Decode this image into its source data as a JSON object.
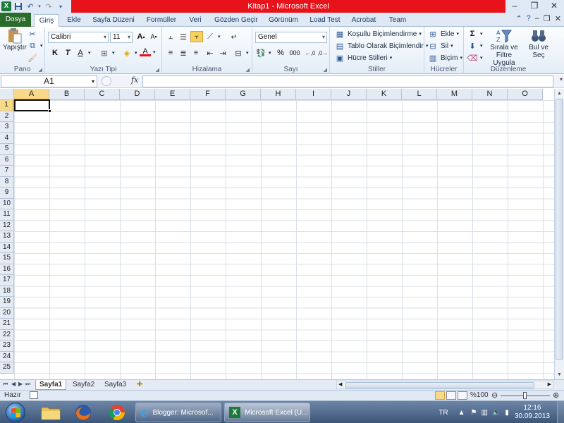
{
  "window": {
    "title": "Kitap1  -  Microsoft Excel",
    "app_logo": "X"
  },
  "ribbon_tabs": [
    "Dosya",
    "Giriş",
    "Ekle",
    "Sayfa Düzeni",
    "Formüller",
    "Veri",
    "Gözden Geçir",
    "Görünüm",
    "Load Test",
    "Acrobat",
    "Team"
  ],
  "active_tab": "Giriş",
  "ribbon": {
    "clipboard": {
      "label": "Pano",
      "paste": "Yapıştır"
    },
    "font": {
      "label": "Yazı Tipi",
      "family": "Calibri",
      "size": "11",
      "bold": "K",
      "italic": "T",
      "underline": "A"
    },
    "alignment": {
      "label": "Hizalama"
    },
    "number": {
      "label": "Sayı",
      "format": "Genel",
      "percent": "%",
      "thousands": "000"
    },
    "styles": {
      "label": "Stiller",
      "conditional": "Koşullu Biçimlendirme",
      "table": "Tablo Olarak Biçimlendir",
      "cell_styles": "Hücre Stilleri"
    },
    "cells": {
      "label": "Hücreler",
      "insert": "Ekle",
      "delete": "Sil",
      "format": "Biçim"
    },
    "editing": {
      "label": "Düzenleme",
      "sort_filter": "Sırala ve Filtre Uygula",
      "find_select": "Bul ve Seç"
    }
  },
  "formula_bar": {
    "name_box": "A1",
    "fx": "fx",
    "value": ""
  },
  "grid": {
    "columns": [
      "A",
      "B",
      "C",
      "D",
      "E",
      "F",
      "G",
      "H",
      "I",
      "J",
      "K",
      "L",
      "M",
      "N",
      "O"
    ],
    "rows": [
      "1",
      "2",
      "3",
      "4",
      "5",
      "6",
      "7",
      "8",
      "9",
      "10",
      "11",
      "12",
      "13",
      "14",
      "15",
      "16",
      "17",
      "18",
      "19",
      "20",
      "21",
      "22",
      "23",
      "24",
      "25"
    ],
    "active_cell": "A1"
  },
  "sheets": [
    "Sayfa1",
    "Sayfa2",
    "Sayfa3"
  ],
  "active_sheet": "Sayfa1",
  "status": {
    "ready": "Hazır",
    "zoom": "%100",
    "zoom_level": 100
  },
  "taskbar": {
    "apps": [
      {
        "label": "Blogger: Microsof..."
      },
      {
        "label": "Microsoft Excel (U..."
      }
    ],
    "language": "TR",
    "time": "12:16",
    "date": "30.09.2013"
  },
  "colors": {
    "title_bar": "#e8121b",
    "file_tab": "#2a6c2c",
    "selected_header": "#f8d889"
  }
}
